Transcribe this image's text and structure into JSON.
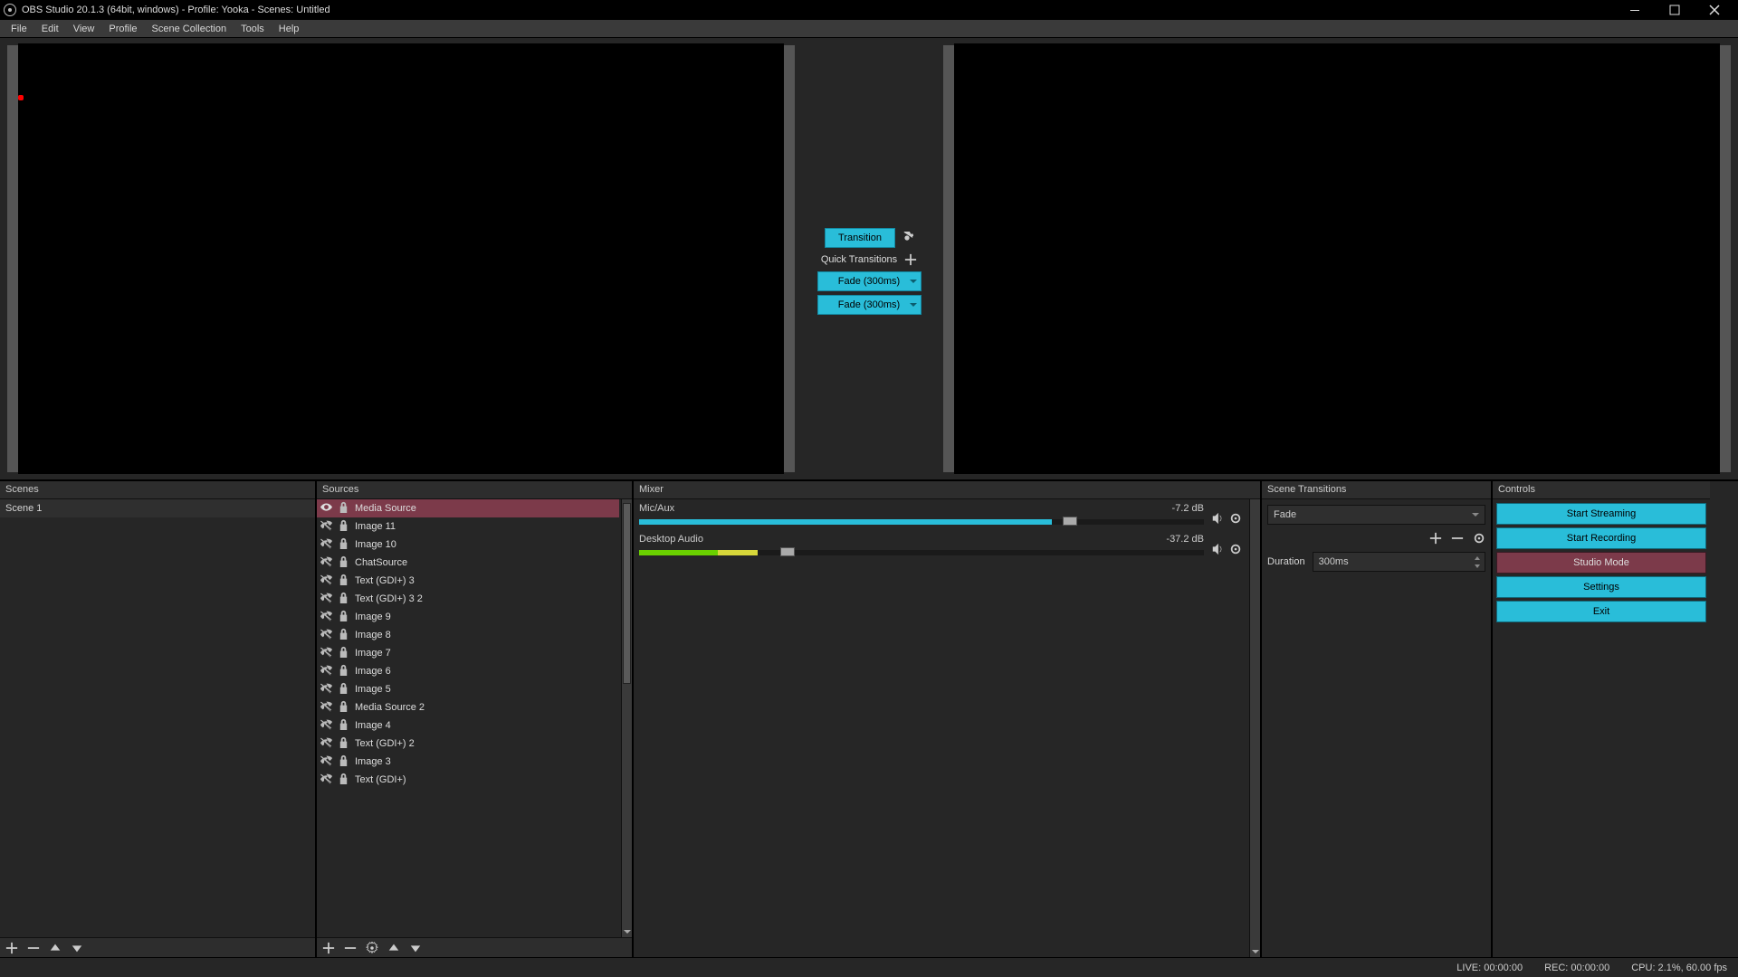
{
  "titlebar": {
    "title": "OBS Studio 20.1.3 (64bit, windows) - Profile: Yooka - Scenes: Untitled"
  },
  "menu": [
    "File",
    "Edit",
    "View",
    "Profile",
    "Scene Collection",
    "Tools",
    "Help"
  ],
  "transition_panel": {
    "transition_btn": "Transition",
    "quick_label": "Quick Transitions",
    "quick_items": [
      "Fade (300ms)",
      "Fade (300ms)"
    ]
  },
  "panels": {
    "scenes": {
      "title": "Scenes",
      "items": [
        "Scene 1"
      ]
    },
    "sources": {
      "title": "Sources",
      "items": [
        {
          "label": "Media Source",
          "visible": true,
          "selected": true
        },
        {
          "label": "Image 11",
          "visible": false,
          "selected": false
        },
        {
          "label": "Image 10",
          "visible": false,
          "selected": false
        },
        {
          "label": "ChatSource",
          "visible": false,
          "selected": false
        },
        {
          "label": "Text (GDI+) 3",
          "visible": false,
          "selected": false
        },
        {
          "label": "Text (GDI+) 3 2",
          "visible": false,
          "selected": false
        },
        {
          "label": "Image 9",
          "visible": false,
          "selected": false
        },
        {
          "label": "Image 8",
          "visible": false,
          "selected": false
        },
        {
          "label": "Image 7",
          "visible": false,
          "selected": false
        },
        {
          "label": "Image 6",
          "visible": false,
          "selected": false
        },
        {
          "label": "Image 5",
          "visible": false,
          "selected": false
        },
        {
          "label": "Media Source 2",
          "visible": false,
          "selected": false
        },
        {
          "label": "Image 4",
          "visible": false,
          "selected": false
        },
        {
          "label": "Text (GDI+) 2",
          "visible": false,
          "selected": false
        },
        {
          "label": "Image 3",
          "visible": false,
          "selected": false
        },
        {
          "label": "Text (GDI+)",
          "visible": false,
          "selected": false
        }
      ]
    },
    "mixer": {
      "title": "Mixer",
      "channels": [
        {
          "name": "Mic/Aux",
          "db": "-7.2 dB",
          "fill_pct": 73,
          "yellow_start": 0,
          "yellow_pct": 0,
          "slider_pct": 75
        },
        {
          "name": "Desktop Audio",
          "db": "-37.2 dB",
          "fill_pct": 14,
          "yellow_start": 14,
          "yellow_pct": 7,
          "slider_pct": 25
        }
      ]
    },
    "transitions": {
      "title": "Scene Transitions",
      "selected": "Fade",
      "duration_label": "Duration",
      "duration_value": "300ms"
    },
    "controls": {
      "title": "Controls",
      "buttons": [
        {
          "label": "Start Streaming",
          "active": false
        },
        {
          "label": "Start Recording",
          "active": false
        },
        {
          "label": "Studio Mode",
          "active": true
        },
        {
          "label": "Settings",
          "active": false
        },
        {
          "label": "Exit",
          "active": false
        }
      ]
    }
  },
  "statusbar": {
    "live": "LIVE: 00:00:00",
    "rec": "REC: 00:00:00",
    "cpu": "CPU: 2.1%, 60.00 fps"
  }
}
